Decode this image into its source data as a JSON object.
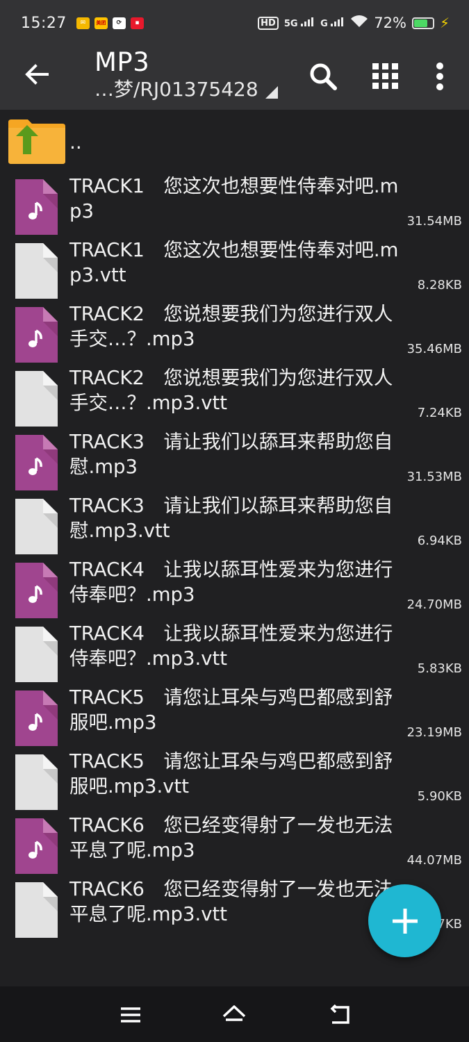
{
  "status_bar": {
    "time": "15:27",
    "network_hd": "HD",
    "network_5g": "5G",
    "network_g": "G",
    "battery_percent": "72%",
    "battery_level": 0.72,
    "notification_icons": [
      "mail-icon",
      "meituan-icon",
      "tool-icon",
      "app-icon"
    ],
    "notification_labels": [
      "",
      "美团",
      "",
      ""
    ]
  },
  "app_bar": {
    "title": "MP3",
    "path": "…梦/RJ01375428",
    "icons": [
      "back-arrow-icon",
      "search-icon",
      "grid-view-icon",
      "more-vert-icon"
    ]
  },
  "parent_entry": {
    "label": ".."
  },
  "files": [
    {
      "name": "TRACK1　您这次也想要性侍奉对吧.mp3",
      "size": "31.54MB",
      "type": "audio"
    },
    {
      "name": "TRACK1　您这次也想要性侍奉对吧.mp3.vtt",
      "size": "8.28KB",
      "type": "text"
    },
    {
      "name": "TRACK2　您说想要我们为您进行双人手交…？.mp3",
      "size": "35.46MB",
      "type": "audio"
    },
    {
      "name": "TRACK2　您说想要我们为您进行双人手交…？.mp3.vtt",
      "size": "7.24KB",
      "type": "text"
    },
    {
      "name": "TRACK3　请让我们以舔耳来帮助您自慰.mp3",
      "size": "31.53MB",
      "type": "audio"
    },
    {
      "name": "TRACK3　请让我们以舔耳来帮助您自慰.mp3.vtt",
      "size": "6.94KB",
      "type": "text"
    },
    {
      "name": "TRACK4　让我以舔耳性爱来为您进行侍奉吧？.mp3",
      "size": "24.70MB",
      "type": "audio"
    },
    {
      "name": "TRACK4　让我以舔耳性爱来为您进行侍奉吧？.mp3.vtt",
      "size": "5.83KB",
      "type": "text"
    },
    {
      "name": "TRACK5　请您让耳朵与鸡巴都感到舒服吧.mp3",
      "size": "23.19MB",
      "type": "audio"
    },
    {
      "name": "TRACK5　请您让耳朵与鸡巴都感到舒服吧.mp3.vtt",
      "size": "5.90KB",
      "type": "text"
    },
    {
      "name": "TRACK6　您已经变得射了一发也无法平息了呢.mp3",
      "size": "44.07MB",
      "type": "audio"
    },
    {
      "name": "TRACK6　您已经变得射了一发也无法平息了呢.mp3.vtt",
      "size": "7KB",
      "type": "text"
    }
  ],
  "fab": {
    "icon": "add-icon"
  },
  "nav_bar": {
    "icons": [
      "menu-icon",
      "home-icon",
      "back-icon"
    ]
  },
  "colors": {
    "bar_bg": "#333335",
    "list_bg": "#202022",
    "audio_file": "#a0458f",
    "text_file": "#e2e2e2",
    "folder": "#f5a623",
    "folder_arrow": "#5a9a1c",
    "fab": "#1fb7d2"
  }
}
